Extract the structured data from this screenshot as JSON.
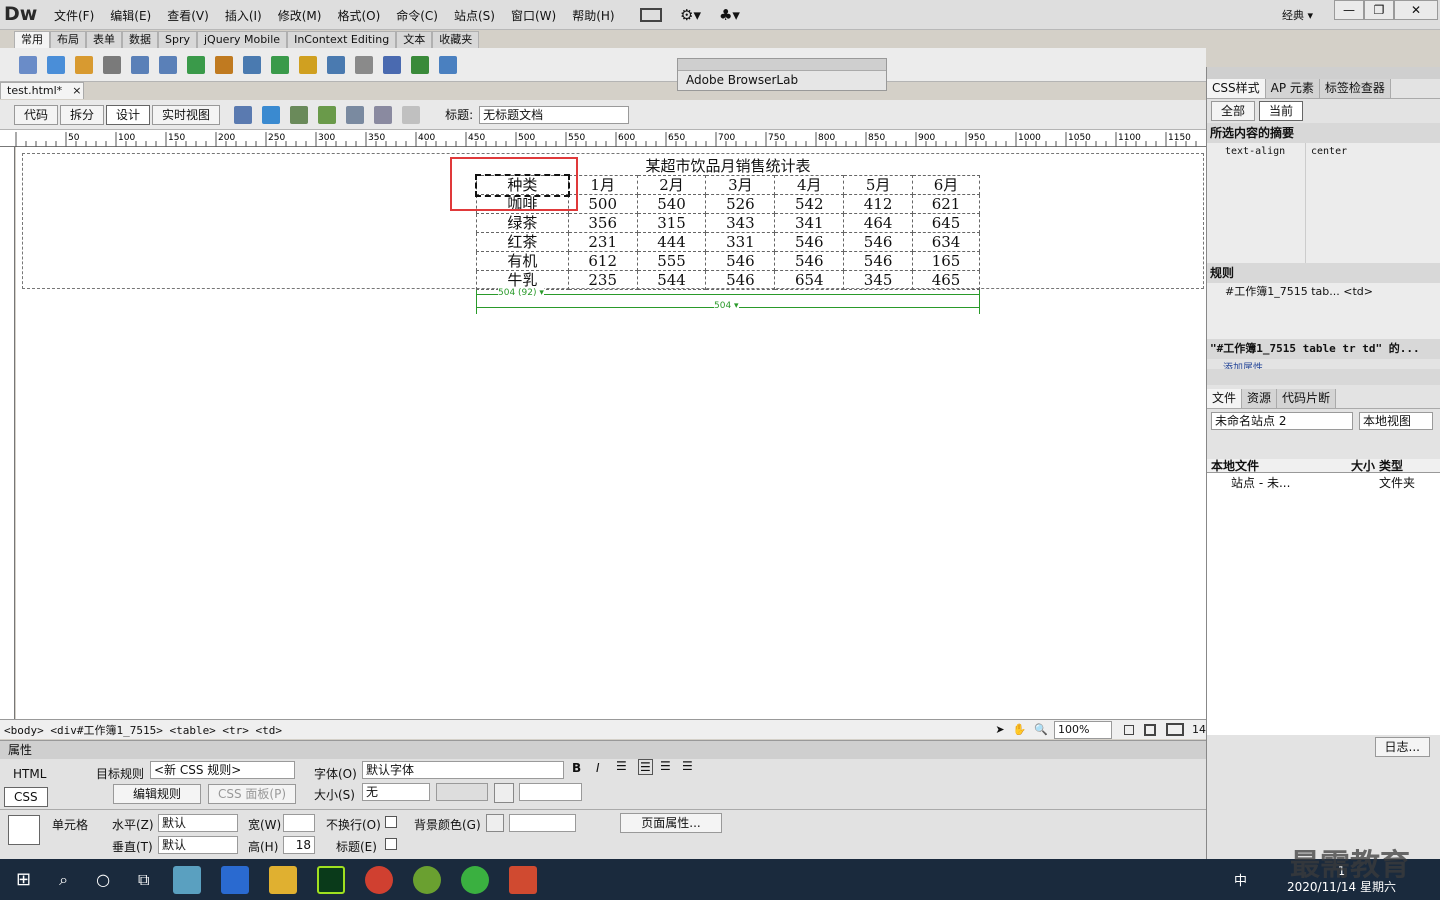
{
  "app": {
    "logo": "Dw",
    "workspace": "经典 ▾"
  },
  "menu": [
    "文件(F)",
    "编辑(E)",
    "查看(V)",
    "插入(I)",
    "修改(M)",
    "格式(O)",
    "命令(C)",
    "站点(S)",
    "窗口(W)",
    "帮助(H)"
  ],
  "window_controls": {
    "minimize": "—",
    "restore": "❐",
    "close": "✕"
  },
  "insert_tabs": [
    "常用",
    "布局",
    "表单",
    "数据",
    "Spry",
    "jQuery Mobile",
    "InContext Editing",
    "文本",
    "收藏夹"
  ],
  "floating_panel": {
    "title": "Adobe BrowserLab"
  },
  "document": {
    "tab_label": "test.html*",
    "view_buttons": [
      "代码",
      "拆分",
      "设计",
      "实时视图"
    ],
    "title_label": "标题:",
    "title_value": "无标题文档"
  },
  "ruler_labels": [
    "50",
    "100",
    "150",
    "200",
    "250",
    "300",
    "350",
    "400",
    "450",
    "500",
    "550",
    "600",
    "650",
    "700",
    "750",
    "800",
    "850",
    "900",
    "950",
    "1000",
    "1050",
    "1100",
    "1150"
  ],
  "table": {
    "caption": "某超市饮品月销售统计表",
    "rows": [
      [
        "种类",
        "1月",
        "2月",
        "3月",
        "4月",
        "5月",
        "6月"
      ],
      [
        "咖啡",
        "500",
        "540",
        "526",
        "542",
        "412",
        "621"
      ],
      [
        "绿茶",
        "356",
        "315",
        "343",
        "341",
        "464",
        "645"
      ],
      [
        "红茶",
        "231",
        "444",
        "331",
        "546",
        "546",
        "634"
      ],
      [
        "有机",
        "612",
        "555",
        "546",
        "546",
        "546",
        "165"
      ],
      [
        "牛乳",
        "235",
        "544",
        "546",
        "654",
        "345",
        "465"
      ]
    ],
    "width_label_col": "504 (92) ▾",
    "width_label_table": "504 ▾"
  },
  "status": {
    "tag_path": "<body> <div#工作簿1_7515> <table> <tr> <td>",
    "zoom": "100%",
    "size": "14"
  },
  "properties": {
    "header": "属性",
    "html_btn": "HTML",
    "css_btn": "CSS",
    "target_rule_label": "目标规则",
    "target_rule_value": "<新 CSS 规则>",
    "edit_rule_btn": "编辑规则",
    "css_panel_btn": "CSS 面板(P)",
    "font_label": "字体(O)",
    "font_value": "默认字体",
    "size_label": "大小(S)",
    "size_value": "无",
    "cell_label": "单元格",
    "horz_label": "水平(Z)",
    "horz_value": "默认",
    "vert_label": "垂直(T)",
    "vert_value": "默认",
    "width_label": "宽(W)",
    "height_label": "高(H)",
    "height_value": "18",
    "nowrap_label": "不换行(O)",
    "header_label": "标题(E)",
    "bgcolor_label": "背景颜色(G)",
    "page_props_btn": "页面属性..."
  },
  "css_panel": {
    "tabs": [
      "CSS样式",
      "AP 元素",
      "标签检查器"
    ],
    "mode_tabs": [
      "全部",
      "当前"
    ],
    "summary_header": "所选内容的摘要",
    "summary_prop": "text-align",
    "summary_value": "center",
    "rules_header": "规则",
    "rule_text": "#工作簿1_7515 tab... <td>",
    "props_header": "\"#工作簿1_7515 table tr td\" 的...",
    "add_prop": "添加属性"
  },
  "files_panel": {
    "tabs": [
      "文件",
      "资源",
      "代码片断"
    ],
    "site": "未命名站点 2",
    "view": "本地视图",
    "col_local": "本地文件",
    "col_size": "大小",
    "col_type": "类型",
    "item_name": "站点 - 未...",
    "item_type": "文件夹",
    "log_btn": "日志..."
  },
  "taskbar": {
    "time": "1",
    "date": "2020/11/14 星期六",
    "ime": "中",
    "watermark": "最需教育"
  }
}
